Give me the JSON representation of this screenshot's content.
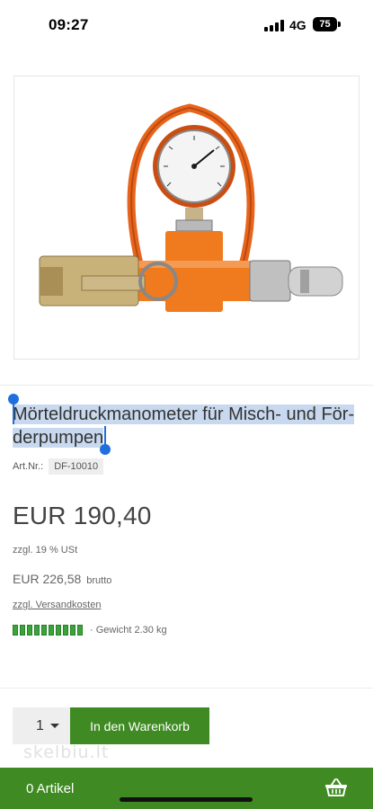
{
  "status_bar": {
    "time": "09:27",
    "network": "4G",
    "battery": "75"
  },
  "product": {
    "image_alt": "Mörteldruckmanometer",
    "title": "Mörteldruckmanometer für Misch- und Förderpumpen",
    "title_line1": "Mörteldruckmanometer für Misch- und För-",
    "title_line2": "derpumpen",
    "art_nr_label": "Art.Nr.:",
    "art_nr": "DF-10010",
    "price": "EUR 190,40",
    "tax_note": "zzgl. 19 % USt",
    "brutto_price": "EUR 226,58",
    "brutto_label": "brutto",
    "shipping_link": "zzgl. Versandkosten",
    "weight": "· Gewicht 2.30 kg",
    "stock_level_bars": 10
  },
  "cart": {
    "quantity": "1",
    "add_button_label": "In den Warenkorb"
  },
  "watermark": "skelbiu.lt",
  "bottom_bar": {
    "cart_count": "0 Artikel"
  },
  "colors": {
    "accent_green": "#3f8a23",
    "selection": "#c8d9ef",
    "selection_handle": "#1f6fde"
  }
}
